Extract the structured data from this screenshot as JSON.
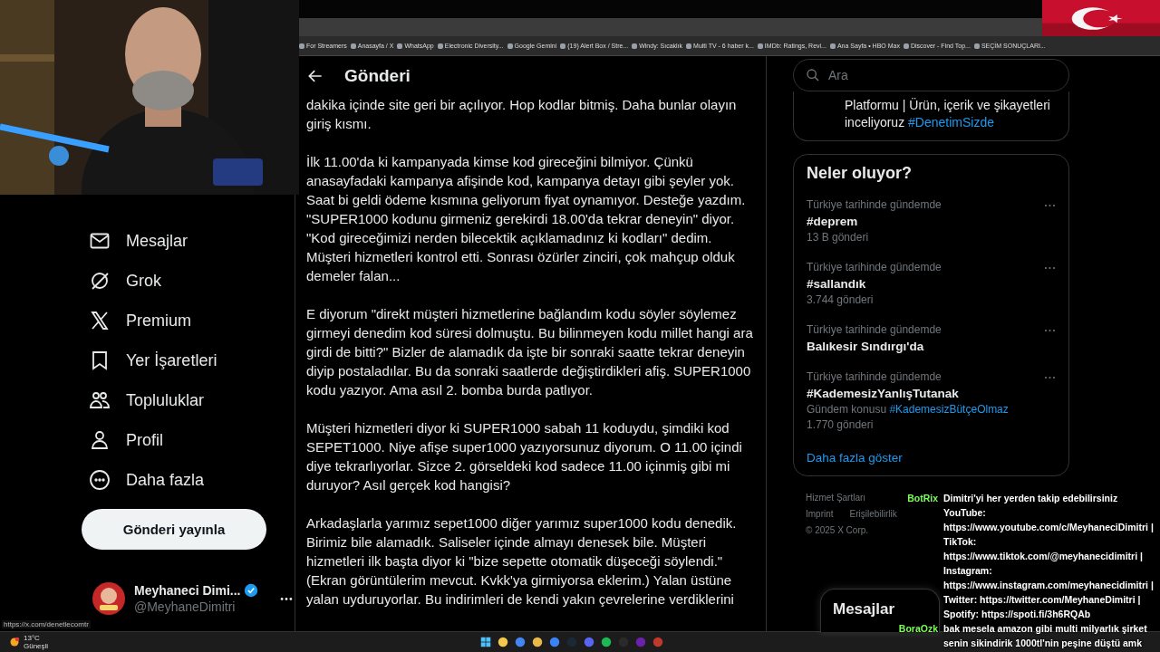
{
  "browser": {
    "bookmarks": [
      {
        "label": "For Streamers"
      },
      {
        "label": "Anasayfa / X"
      },
      {
        "label": "WhatsApp"
      },
      {
        "label": "Electronic Diversity..."
      },
      {
        "label": "Google Gemini"
      },
      {
        "label": "(19) Alert Box / Stre..."
      },
      {
        "label": "Windy: Sıcaklık"
      },
      {
        "label": "Multi TV - 6 haber k..."
      },
      {
        "label": "IMDb: Ratings, Revi..."
      },
      {
        "label": "Ana Sayfa • HBO Max"
      },
      {
        "label": "Discover - Find Top..."
      },
      {
        "label": "SEÇİM SONUÇLARI..."
      }
    ]
  },
  "nav": {
    "items": [
      {
        "label": "Mesajlar",
        "kind": "mail"
      },
      {
        "label": "Grok",
        "kind": "grok"
      },
      {
        "label": "Premium",
        "kind": "x"
      },
      {
        "label": "Yer İşaretleri",
        "kind": "bookmark"
      },
      {
        "label": "Topluluklar",
        "kind": "people"
      },
      {
        "label": "Profil",
        "kind": "person"
      },
      {
        "label": "Daha fazla",
        "kind": "more"
      }
    ],
    "post_button": "Gönderi yayınla",
    "account": {
      "name": "Meyhaneci Dimi...",
      "handle": "@MeyhaneDimitri",
      "verified": true
    }
  },
  "post": {
    "title": "Gönderi",
    "paragraphs": [
      "dakika içinde site geri bir açılıyor. Hop kodlar bitmiş. Daha bunlar olayın giriş kısmı.",
      "İlk 11.00'da ki kampanyada kimse kod gireceğini bilmiyor. Çünkü anasayfadaki kampanya afişinde kod, kampanya detayı gibi şeyler yok. Saat bi geldi ödeme kısmına geliyorum fiyat oynamıyor. Desteğe yazdım. \"SUPER1000 kodunu girmeniz gerekirdi 18.00'da tekrar deneyin\" diyor. \"Kod gireceğimizi nerden bilecektik açıklamadınız ki kodları\" dedim. Müşteri hizmetleri kontrol etti. Sonrası özürler zinciri, çok mahçup olduk demeler falan...",
      "E diyorum \"direkt müşteri hizmetlerine bağlandım kodu söyler söylemez girmeyi denedim kod süresi dolmuştu. Bu bilinmeyen kodu millet hangi ara girdi de bitti?\" Bizler de alamadık da işte bir sonraki saatte tekrar deneyin diyip postaladılar. Bu da sonraki saatlerde değiştirdikleri afiş. SUPER1000 kodu yazıyor. Ama asıl 2. bomba burda patlıyor.",
      "Müşteri hizmetleri diyor ki SUPER1000 sabah 11 koduydu, şimdiki kod SEPET1000. Niye afişe super1000 yazıyorsunuz diyorum. O 11.00 içindi diye tekrarlıyorlar. Sizce 2. görseldeki kod sadece 11.00 içinmiş gibi mi duruyor? Asıl gerçek kod hangisi?",
      "Arkadaşlarla yarımız sepet1000 diğer yarımız super1000 kodu denedik. Birimiz bile alamadık. Saliseler içinde almayı denesek bile. Müşteri hizmetleri ilk başta diyor ki \"bize sepette otomatik düşeceği söylendi.\" (Ekran görüntülerim mevcut. Kvkk'ya girmiyorsa eklerim.) Yalan üstüne yalan uyduruyorlar. Bu indirimleri de kendi yakın çevrelerine verdiklerini"
    ]
  },
  "sidebar": {
    "search": {
      "placeholder": "Ara"
    },
    "bio_card": {
      "text": "Platformu | Ürün, içerik ve şikayetleri inceliyoruz",
      "hashtag": "#DenetimSizde"
    },
    "trends": {
      "title": "Neler oluyor?",
      "items": [
        {
          "context": "Türkiye tarihinde gündemde",
          "title": "#deprem",
          "count": "13 B gönderi"
        },
        {
          "context": "Türkiye tarihinde gündemde",
          "title": "#sallandık",
          "count": "3.744 gönderi"
        },
        {
          "context": "Türkiye tarihinde gündemde",
          "title": "Balıkesir Sındırgı'da"
        },
        {
          "context": "Türkiye tarihinde gündemde",
          "title": "#KademesizYanlışTutanak",
          "topic_label": "Gündem konusu",
          "topic_link": "#KademesizBütçeOlmaz",
          "count": "1.770 gönderi"
        }
      ],
      "show_more": "Daha fazla göster"
    },
    "footer_links": [
      [
        "Hizmet Şartları"
      ],
      [
        "Imprint",
        "Erişilebilirlik"
      ]
    ],
    "copyright": "© 2025 X Corp."
  },
  "messages_drawer": {
    "title": "Mesajlar"
  },
  "chat": [
    {
      "user": "BotRix",
      "text": "Dimitri'yi her yerden takip edebilirsiniz YouTube: https://www.youtube.com/c/MeyhaneciDimitri | TikTok: https://www.tiktok.com/@meyhanecidimitri | Instagram: https://www.instagram.com/meyhanecidimitri | Twitter: https://twitter.com/MeyhaneDimitri | Spotify: https://spoti.fi/3h6RQAb"
    },
    {
      "user": "BoraOzk",
      "text": "bak mesela amazon gibi multi milyarlık şirket senin sikindirik 1000tl'nin peşine düştü amk"
    }
  ],
  "status_url": "https://x.com/denetlecomtr",
  "taskbar": {
    "weather": {
      "temp": "13°C",
      "condition": "Güneşli"
    }
  }
}
